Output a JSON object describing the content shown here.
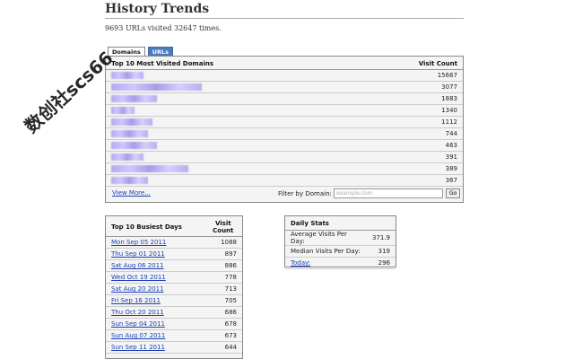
{
  "header": {
    "title": "History Trends",
    "summary": "9693 URLs visited 32647 times."
  },
  "tabs": [
    {
      "label": "Domains"
    },
    {
      "label": "URLs"
    }
  ],
  "domains": {
    "heading": "Top 10 Most Visited Domains",
    "count_heading": "Visit Count",
    "rows": [
      {
        "count": "15667",
        "blur": 0.22
      },
      {
        "count": "3077",
        "blur": 0.61
      },
      {
        "count": "1883",
        "blur": 0.31
      },
      {
        "count": "1340",
        "blur": 0.16
      },
      {
        "count": "1112",
        "blur": 0.28
      },
      {
        "count": "744",
        "blur": 0.25
      },
      {
        "count": "463",
        "blur": 0.31
      },
      {
        "count": "391",
        "blur": 0.22
      },
      {
        "count": "389",
        "blur": 0.52
      },
      {
        "count": "367",
        "blur": 0.25
      }
    ],
    "view_more": "View More...",
    "filter_label": "Filter by Domain:",
    "filter_placeholder": "example.com",
    "go_label": "Go"
  },
  "busiest_days": {
    "heading": "Top 10 Busiest Days",
    "count_heading_line1": "Visit",
    "count_heading_line2": "Count",
    "rows": [
      {
        "day": "Mon Sep 05 2011",
        "count": "1088"
      },
      {
        "day": "Thu Sep 01 2011",
        "count": "897"
      },
      {
        "day": "Sat Aug 06 2011",
        "count": "886"
      },
      {
        "day": "Wed Oct 19 2011",
        "count": "778"
      },
      {
        "day": "Sat Aug 20 2011",
        "count": "713"
      },
      {
        "day": "Fri Sep 16 2011",
        "count": "705"
      },
      {
        "day": "Thu Oct 20 2011",
        "count": "686"
      },
      {
        "day": "Sun Sep 04 2011",
        "count": "678"
      },
      {
        "day": "Sun Aug 07 2011",
        "count": "673"
      },
      {
        "day": "Sun Sep 11 2011",
        "count": "644"
      }
    ]
  },
  "daily_stats": {
    "heading": "Daily Stats",
    "rows": [
      {
        "label": "Average Visits Per Day:",
        "value": "371.9"
      },
      {
        "label": "Median Visits Per Day:",
        "value": "319"
      },
      {
        "label": "Today:",
        "value": "296"
      }
    ]
  },
  "watermark": "数创社scs66"
}
